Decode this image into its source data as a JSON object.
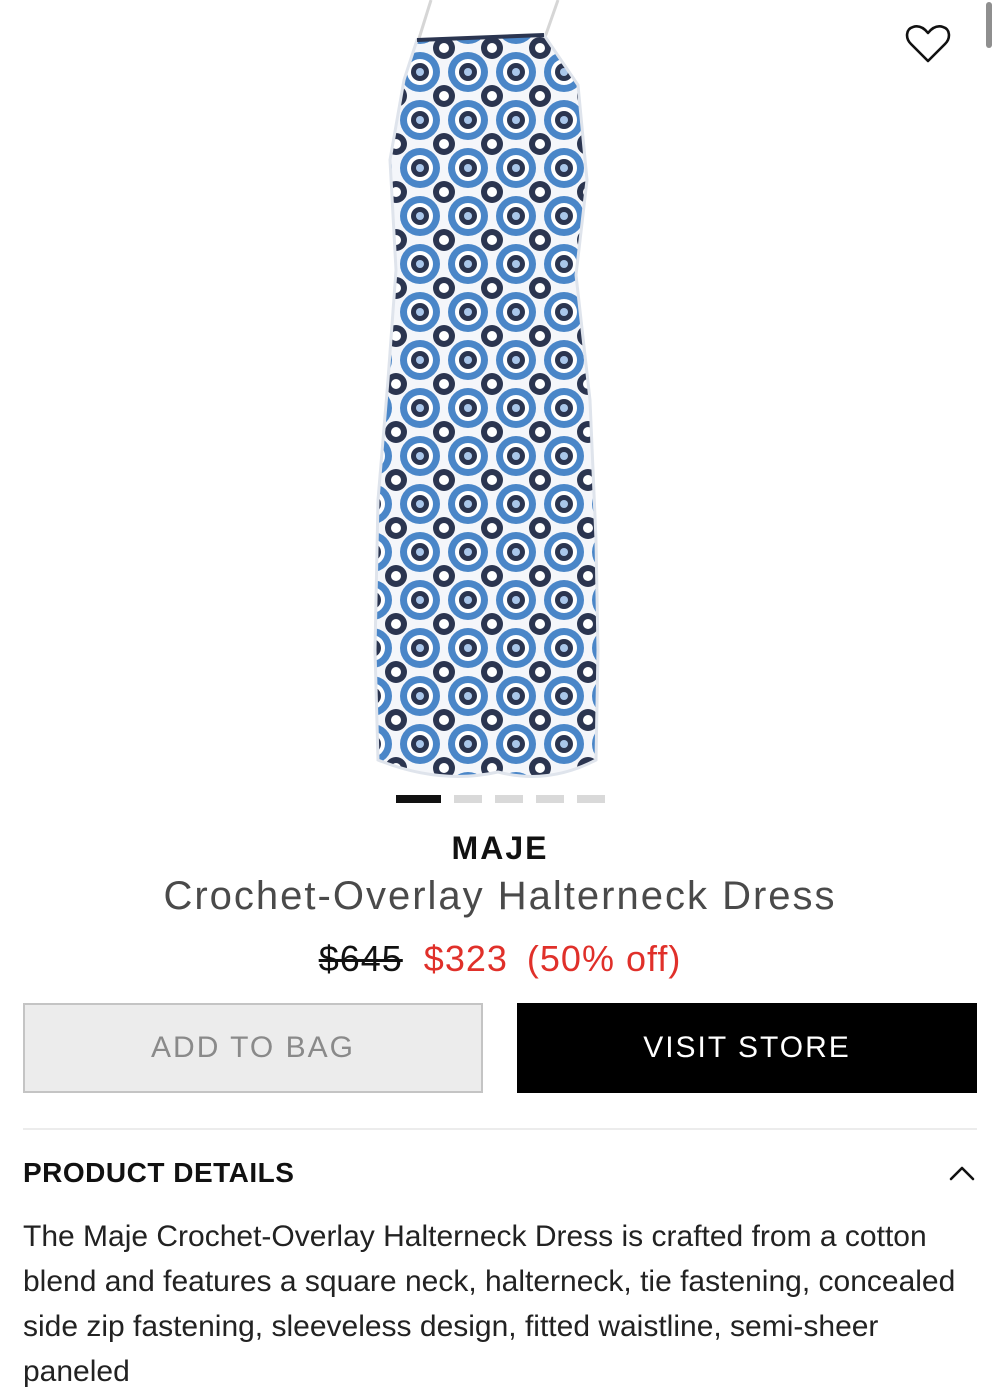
{
  "product": {
    "brand": "MAJE",
    "name": "Crochet-Overlay Halterneck Dress",
    "price_original": "$645",
    "price_sale": "$323",
    "discount": "(50% off)"
  },
  "carousel": {
    "total": 5,
    "active": 1
  },
  "actions": {
    "add_to_bag": "ADD TO BAG",
    "visit_store": "VISIT STORE"
  },
  "details": {
    "title": "PRODUCT DETAILS",
    "description": "The Maje Crochet-Overlay Halterneck Dress is crafted from a cotton blend and features a square neck, halterneck, tie fastening, concealed side zip fastening, sleeveless design, fitted waistline, semi-sheer paneled"
  },
  "icons": {
    "favorite": "heart-icon",
    "collapse": "chevron-up-icon"
  },
  "colors": {
    "sale": "#e0302a",
    "primary_button": "#000000",
    "dress_blue": "#4a86c8",
    "dress_navy": "#2b3550"
  }
}
